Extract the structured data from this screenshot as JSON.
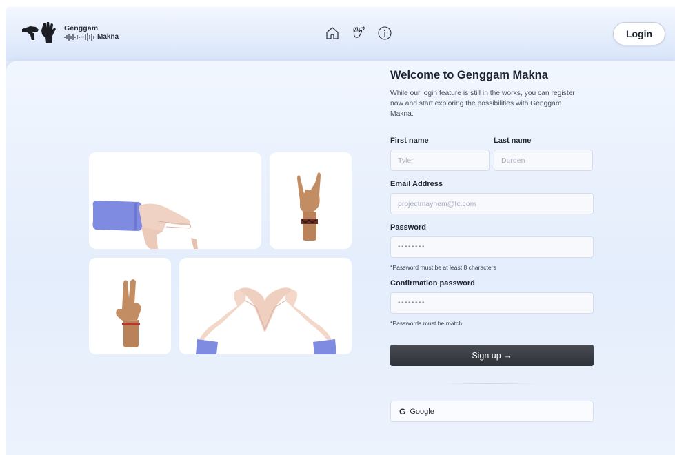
{
  "header": {
    "logo": {
      "title": "Genggam",
      "subtitle": "Makna"
    },
    "nav": [
      {
        "icon": "home-icon"
      },
      {
        "icon": "waving-hand-icon"
      },
      {
        "icon": "info-icon"
      }
    ],
    "login_label": "Login"
  },
  "form": {
    "title": "Welcome to Genggam Makna",
    "description": "While our login feature is still in the works, you can register now and start exploring the possibilities with Genggam Makna.",
    "first_name": {
      "label": "First name",
      "placeholder": "Tyler"
    },
    "last_name": {
      "label": "Last name",
      "placeholder": "Durden"
    },
    "email": {
      "label": "Email Address",
      "placeholder": "projectmayhem@fc.com"
    },
    "password": {
      "label": "Password",
      "value": "••••••••",
      "hint": "*Password must be at least 8 characters"
    },
    "confirm_password": {
      "label": "Confirmation password",
      "value": "••••••••",
      "hint": "*Passwords must be match"
    },
    "signup_label": "Sign up →",
    "google_icon": "G",
    "google_label": "Google"
  },
  "gallery": [
    {
      "icon": "pointing-hands-icon"
    },
    {
      "icon": "rock-hand-icon"
    },
    {
      "icon": "peace-hand-icon"
    },
    {
      "icon": "heart-hands-icon"
    }
  ],
  "colors": {
    "accent_dark": "#2f3138",
    "background": "#e3ecfb",
    "sleeve": "#7f8be0",
    "skin_light": "#f0d2c4",
    "skin_tan": "#c38d63"
  }
}
